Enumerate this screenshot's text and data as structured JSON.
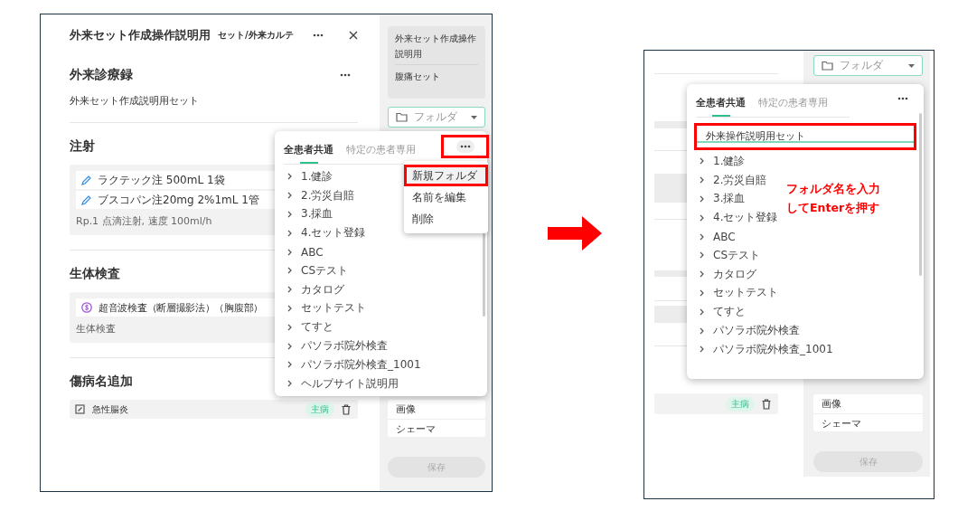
{
  "screens": [
    {
      "kind": "full",
      "header": {
        "title": "外来セット作成操作説明用",
        "subtitle": "セット/外来カルテ"
      },
      "sections": [
        {
          "kind": "text",
          "title": "外来診療録",
          "text": "外来セット作成説明用セット"
        },
        {
          "kind": "orders",
          "title": "注射",
          "items": [
            "ラクテック注 500mL  1袋",
            "ブスコパン注20mg 2%1mL  1管"
          ],
          "note": "Rp.1  点滴注射, 速度 100ml/h"
        },
        {
          "kind": "exams",
          "title": "生体検査",
          "items": [
            "超音波検査（断層撮影法）（胸腹部）"
          ],
          "note": "生体検査"
        },
        {
          "kind": "diagnoses",
          "title": "傷病名追加",
          "items": [
            {
              "text": "急性腸炎",
              "badge": "主病"
            }
          ]
        }
      ],
      "sidebar": {
        "sets": [
          "外来セット作成操作説明用",
          "腹痛セット"
        ],
        "folder_select": {
          "placeholder": "フォルダ"
        },
        "lists": [
          "画像",
          "シェーマ"
        ],
        "save": {
          "label": "保存",
          "disabled": true
        }
      },
      "popup": {
        "tabs": [
          {
            "label": "全患者共通",
            "selected": true
          },
          {
            "label": "特定の患者専用",
            "selected": false
          }
        ],
        "more_highlighted": true,
        "menu": [
          {
            "label": "新規フォルダ",
            "highlighted": true
          },
          {
            "label": "名前を編集",
            "highlighted": false
          },
          {
            "label": "削除",
            "highlighted": false
          }
        ],
        "folders": [
          "1.健診",
          "2.労災自賠",
          "3.採血",
          "4.セット登録",
          "ABC",
          "CSテスト",
          "カタログ",
          "セットテスト",
          "てすと",
          "パソラボ院外検査",
          "パソラボ院外検査_1001",
          "ヘルプサイト説明用"
        ]
      }
    },
    {
      "kind": "cropped",
      "diagnosis_badge": "主病",
      "sidebar": {
        "folder_select": {
          "placeholder": "フォルダ"
        },
        "lists": [
          "画像",
          "シェーマ"
        ],
        "save": {
          "label": "保存",
          "disabled": true
        }
      },
      "popup": {
        "tabs": [
          {
            "label": "全患者共通",
            "selected": true
          },
          {
            "label": "特定の患者専用",
            "selected": false
          }
        ],
        "more_highlighted": false,
        "new_folder": {
          "value": "外来操作説明用セット",
          "highlighted": true
        },
        "folders": [
          "1.健診",
          "2.労災自賠",
          "3.採血",
          "4.セット登録",
          "ABC",
          "CSテスト",
          "カタログ",
          "セットテスト",
          "てすと",
          "パソラボ院外検査",
          "パソラボ院外検査_1001"
        ]
      },
      "annotation": [
        "フォルダ名を入力",
        "してEnterを押す"
      ]
    }
  ]
}
